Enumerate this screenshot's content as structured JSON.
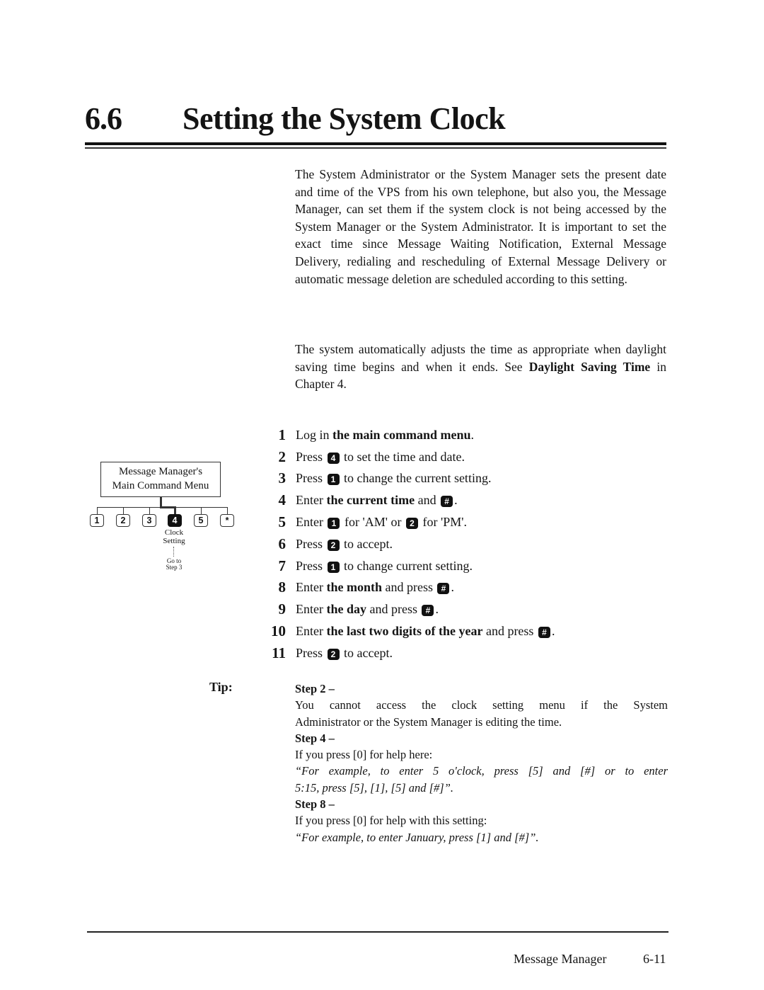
{
  "header": {
    "section_number": "6.6",
    "title": "Setting the System Clock"
  },
  "intro": {
    "paragraph1": "The System Administrator or the System Manager sets the present date and time of the VPS from his own telephone, but also you, the Message Manager, can set them if the system clock is not being accessed by the System Manager or the System Administrator.  It is important to set the exact time since Message Waiting Notification, External Message Delivery, redialing and rescheduling of External Message Delivery or automatic message deletion are scheduled according to this setting.",
    "paragraph2_pre": "The system automatically adjusts the time as appropriate when daylight saving time begins and when it ends.  See ",
    "paragraph2_bold": "Daylight Saving Time",
    "paragraph2_post": " in Chapter 4."
  },
  "diagram": {
    "menu_line1": "Message Manager's",
    "menu_line2": "Main Command Menu",
    "keys": [
      "1",
      "2",
      "3",
      "4",
      "5",
      "*"
    ],
    "active_key": "4",
    "active_label_line1": "Clock",
    "active_label_line2": "Setting",
    "goto_line1": "Go to",
    "goto_line2": "Step 3"
  },
  "steps": [
    {
      "n": "1",
      "parts": [
        {
          "t": "Log in "
        },
        {
          "b": "the main command menu"
        },
        {
          "t": "."
        }
      ]
    },
    {
      "n": "2",
      "parts": [
        {
          "t": "Press "
        },
        {
          "k": "4"
        },
        {
          "t": " to set the time and date."
        }
      ]
    },
    {
      "n": "3",
      "parts": [
        {
          "t": "Press "
        },
        {
          "k": "1"
        },
        {
          "t": " to change the current setting."
        }
      ]
    },
    {
      "n": "4",
      "parts": [
        {
          "t": "Enter "
        },
        {
          "b": "the current time"
        },
        {
          "t": " and "
        },
        {
          "k": "#"
        },
        {
          "t": "."
        }
      ]
    },
    {
      "n": "5",
      "parts": [
        {
          "t": "Enter "
        },
        {
          "k": "1"
        },
        {
          "t": " for 'AM' or "
        },
        {
          "k": "2"
        },
        {
          "t": " for 'PM'."
        }
      ]
    },
    {
      "n": "6",
      "parts": [
        {
          "t": "Press "
        },
        {
          "k": "2"
        },
        {
          "t": " to accept."
        }
      ]
    },
    {
      "n": "7",
      "parts": [
        {
          "t": "Press "
        },
        {
          "k": "1"
        },
        {
          "t": " to change current setting."
        }
      ]
    },
    {
      "n": "8",
      "parts": [
        {
          "t": "Enter "
        },
        {
          "b": "the month"
        },
        {
          "t": " and press "
        },
        {
          "k": "#"
        },
        {
          "t": "."
        }
      ]
    },
    {
      "n": "9",
      "parts": [
        {
          "t": "Enter "
        },
        {
          "b": "the day"
        },
        {
          "t": " and press "
        },
        {
          "k": "#"
        },
        {
          "t": "."
        }
      ]
    },
    {
      "n": "10",
      "parts": [
        {
          "t": "Enter "
        },
        {
          "b": "the last two digits of the year"
        },
        {
          "t": " and press "
        },
        {
          "k": "#"
        },
        {
          "t": "."
        }
      ]
    },
    {
      "n": "11",
      "parts": [
        {
          "t": "Press "
        },
        {
          "k": "2"
        },
        {
          "t": " to accept."
        }
      ]
    }
  ],
  "tip": {
    "label": "Tip:",
    "step2_title": "Step 2 –",
    "step2_line1": "You cannot access the clock setting menu if the System",
    "step2_line2": "Administrator or the System Manager is editing the time.",
    "step4_title": "Step 4 –",
    "step4_text": "If you press [0] for help here:",
    "step4_quote_line1": "“For example, to enter 5 o'clock, press [5] and [#] or to enter",
    "step4_quote_line2": "5:15, press [5], [1], [5] and [#]”.",
    "step8_title": "Step 8 –",
    "step8_text": "If you press [0] for help with this setting:",
    "step8_quote": "“For example, to enter January, press [1] and [#]”."
  },
  "footer": {
    "title": "Message Manager",
    "page": "6-11"
  }
}
